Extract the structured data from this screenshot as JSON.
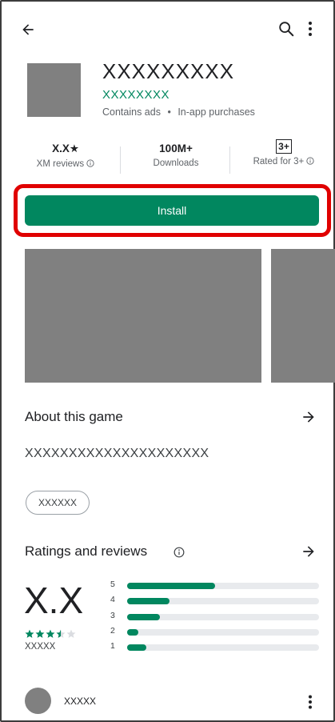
{
  "header": {
    "back_icon": "arrow-left-icon",
    "search_icon": "search-icon",
    "more_icon": "more-vert-icon"
  },
  "app": {
    "name": "XXXXXXXXX",
    "developer": "XXXXXXXX",
    "meta_ads": "Contains ads",
    "meta_sep": "•",
    "meta_iap": "In-app purchases"
  },
  "stats": {
    "rating_value": "X.X★",
    "rating_sub": "XM reviews",
    "downloads_value": "100M+",
    "downloads_sub": "Downloads",
    "content_badge": "3+",
    "content_sub": "Rated for 3+"
  },
  "install": {
    "label": "Install"
  },
  "about": {
    "title": "About this game",
    "description": "XXXXXXXXXXXXXXXXXXXXX",
    "tag": "XXXXXX"
  },
  "ratings": {
    "title": "Ratings and reviews",
    "score": "X.X",
    "review_count": "XXXXX",
    "stars": 3.5,
    "bars": [
      {
        "label": "5",
        "fraction": 0.46
      },
      {
        "label": "4",
        "fraction": 0.22
      },
      {
        "label": "3",
        "fraction": 0.17
      },
      {
        "label": "2",
        "fraction": 0.06
      },
      {
        "label": "1",
        "fraction": 0.1
      }
    ]
  },
  "review": {
    "user": "XXXXX"
  },
  "colors": {
    "accent": "#01875f",
    "highlight": "#e00000",
    "placeholder": "#808080"
  }
}
